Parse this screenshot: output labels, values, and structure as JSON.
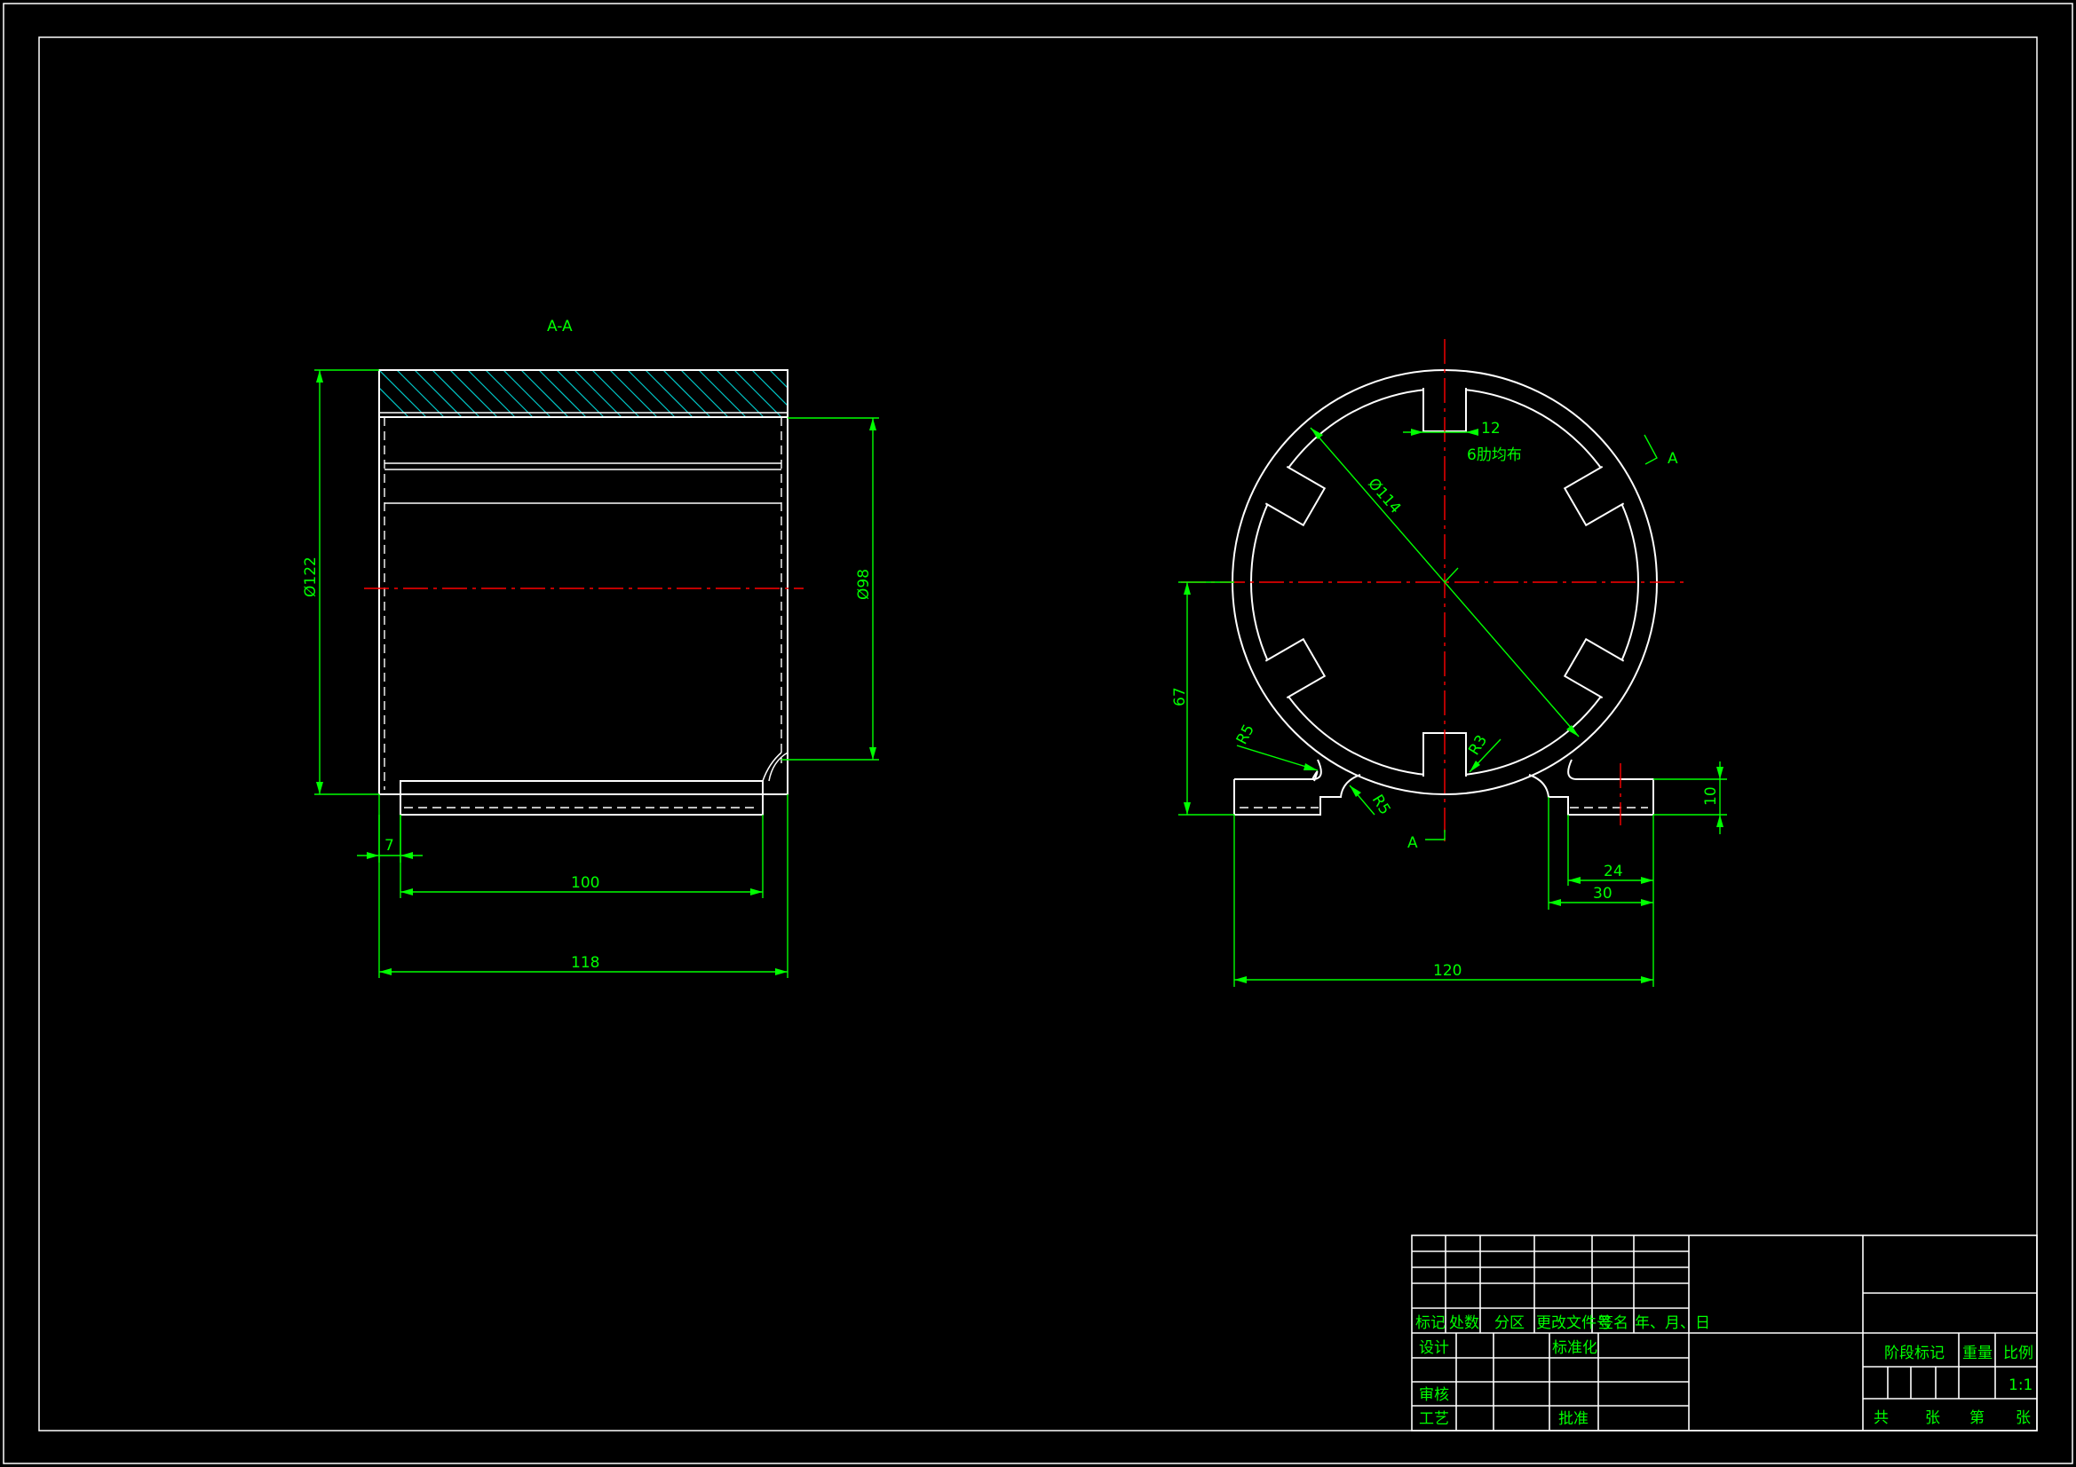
{
  "section_view": {
    "title": "A-A",
    "dims": {
      "outer_dia": "Ø122",
      "inner_dia": "Ø98",
      "wall": "7",
      "inner_len": "100",
      "total_len": "118"
    }
  },
  "front_view": {
    "dims": {
      "rib_width": "12",
      "rib_note": "6肋均布",
      "dia_114": "Ø114",
      "height_67": "67",
      "r5_a": "R5",
      "r5_b": "R5",
      "r3": "R3",
      "foot_10": "10",
      "foot_24": "24",
      "foot_30": "30",
      "width_120": "120"
    },
    "section_mark_top": "A",
    "section_mark_bottom": "A"
  },
  "title_block": {
    "headers": {
      "mark": "标记",
      "count": "处数",
      "zone": "分区",
      "doc_no": "更改文件号",
      "sign": "签名",
      "date": "年、月、日"
    },
    "roles": {
      "design": "设计",
      "standardize": "标准化",
      "review": "审核",
      "process": "工艺",
      "approve": "批准"
    },
    "right": {
      "stage_mark": "阶段标记",
      "weight": "重量",
      "scale_label": "比例",
      "scale_value": "1:1",
      "total": "共",
      "sheets": "张",
      "number": "第",
      "sheet": "张"
    }
  },
  "colors": {
    "background": "#000000",
    "geometry": "#ffffff",
    "dimension": "#00ff00",
    "centerline": "#ff0000",
    "hatch": "#00c8c8"
  }
}
